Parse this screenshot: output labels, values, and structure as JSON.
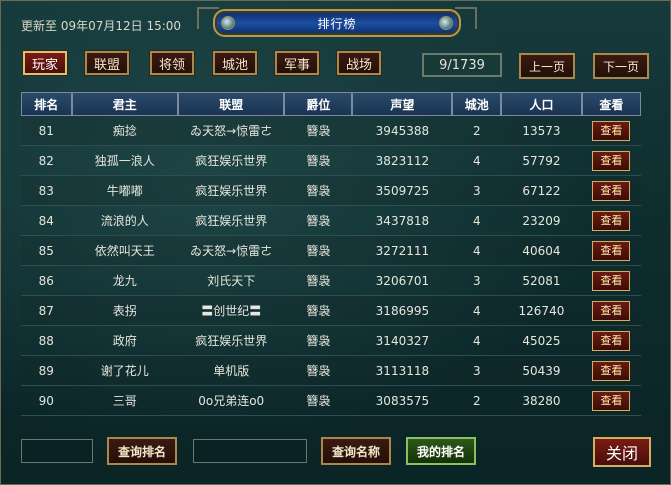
{
  "header": {
    "updated": "更新至 09年07月12日 15:00",
    "title": "排行榜"
  },
  "tabs": [
    {
      "label": "玩家",
      "active": true
    },
    {
      "label": "联盟"
    },
    {
      "label": "将领"
    },
    {
      "label": "城池"
    },
    {
      "label": "军事"
    },
    {
      "label": "战场"
    }
  ],
  "pager": {
    "page": "9/1739",
    "prev": "上一页",
    "next": "下一页"
  },
  "table": {
    "columns": [
      "排名",
      "君主",
      "联盟",
      "爵位",
      "声望",
      "城池",
      "人口",
      "查看"
    ],
    "view_label": "查看",
    "rows": [
      [
        "81",
        "痴捻",
        "ゐ天怒→惊雷ㄜ",
        "簪袅",
        "3945388",
        "2",
        "13573"
      ],
      [
        "82",
        "独孤一浪人",
        "疯狂娱乐世界",
        "簪袅",
        "3823112",
        "4",
        "57792"
      ],
      [
        "83",
        "牛嘟嘟",
        "疯狂娱乐世界",
        "簪袅",
        "3509725",
        "3",
        "67122"
      ],
      [
        "84",
        "流浪的人",
        "疯狂娱乐世界",
        "簪袅",
        "3437818",
        "4",
        "23209"
      ],
      [
        "85",
        "依然叫天王",
        "ゐ天怒→惊雷ㄜ",
        "簪袅",
        "3272111",
        "4",
        "40604"
      ],
      [
        "86",
        "龙九",
        "刘氏天下",
        "簪袅",
        "3206701",
        "3",
        "52081"
      ],
      [
        "87",
        "表拐",
        "〓创世纪〓",
        "簪袅",
        "3186995",
        "4",
        "126740"
      ],
      [
        "88",
        "政府",
        "疯狂娱乐世界",
        "簪袅",
        "3140327",
        "4",
        "45025"
      ],
      [
        "89",
        "谢了花儿",
        "单机版",
        "簪袅",
        "3113118",
        "3",
        "50439"
      ],
      [
        "90",
        "三哥",
        "0o兄弟连o0",
        "簪袅",
        "3083575",
        "2",
        "38280"
      ]
    ]
  },
  "bottom": {
    "query_rank": "查询排名",
    "query_name": "查询名称",
    "my_rank": "我的排名",
    "close": "关闭"
  }
}
